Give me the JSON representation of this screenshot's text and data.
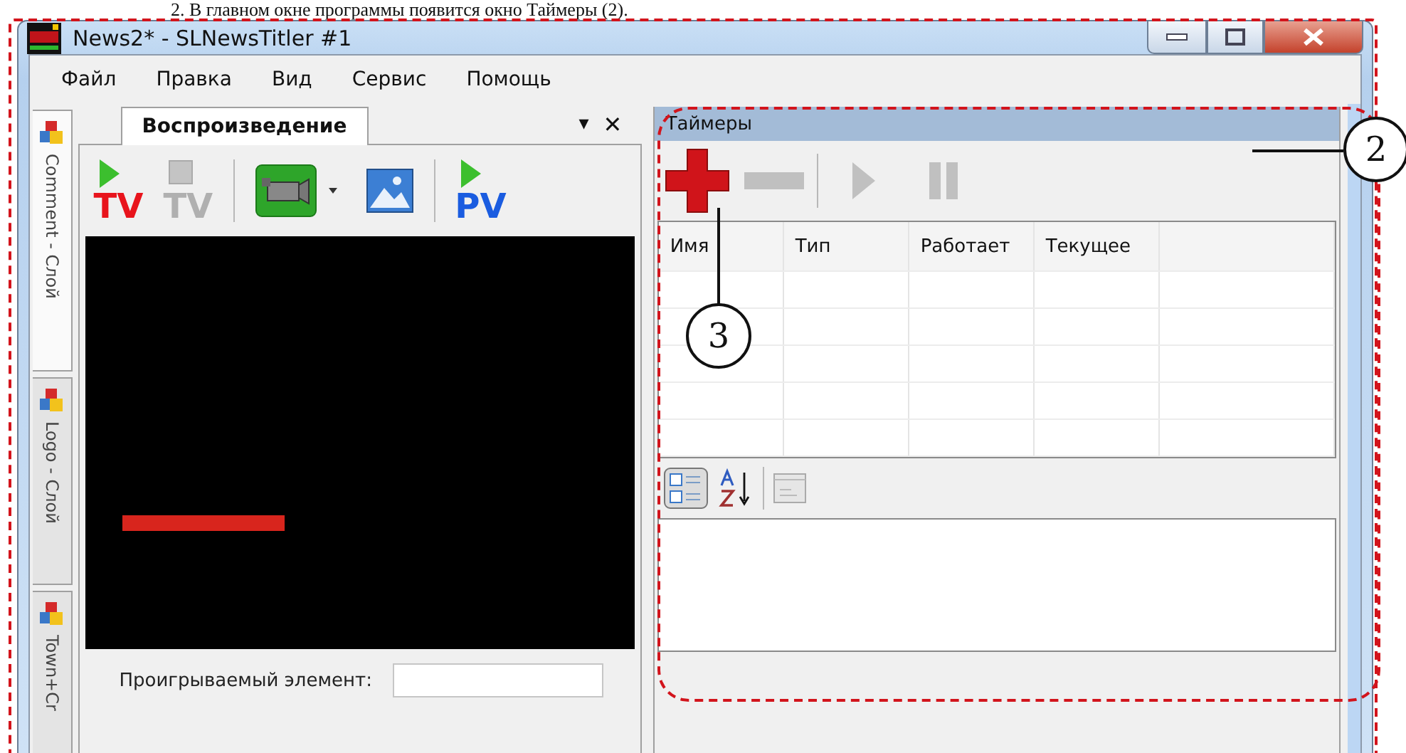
{
  "doc_heading": "2.   В главном окне программы появится окно Таймеры (2).",
  "window": {
    "title": "News2* - SLNewsTitler #1"
  },
  "menu": [
    "Файл",
    "Правка",
    "Вид",
    "Сервис",
    "Помощь"
  ],
  "side_tabs": [
    {
      "label": "Comment - Слой",
      "selected": true
    },
    {
      "label": "Logo - Слой",
      "selected": false
    },
    {
      "label": "Town+Cr",
      "selected": false
    }
  ],
  "playback_panel": {
    "tab": "Воспроизведение",
    "menu_glyph": "▾",
    "close_glyph": "✕",
    "toolbar": [
      {
        "kind": "play",
        "label": "TV",
        "color": "#e8141c",
        "disabled": false
      },
      {
        "kind": "stop",
        "label": "TV",
        "color": "#b0b0b0",
        "disabled": true
      },
      {
        "kind": "separator"
      },
      {
        "kind": "camera"
      },
      {
        "kind": "image"
      },
      {
        "kind": "separator"
      },
      {
        "kind": "play",
        "label": "PV",
        "color": "#1a5ce0",
        "disabled": false
      }
    ],
    "playing_label": "Проигрываемый элемент:"
  },
  "timers_panel": {
    "title": "Таймеры",
    "toolbar": [
      {
        "kind": "add",
        "disabled": false
      },
      {
        "kind": "remove",
        "disabled": true
      },
      {
        "kind": "separator"
      },
      {
        "kind": "start",
        "disabled": true
      },
      {
        "kind": "pause",
        "disabled": true
      }
    ],
    "columns": [
      "Имя",
      "Тип",
      "Работает",
      "Текущее"
    ],
    "property_toolbar": [
      {
        "kind": "categorized",
        "selected": true
      },
      {
        "kind": "alphabetical",
        "selected": false
      },
      {
        "kind": "separator"
      },
      {
        "kind": "pages",
        "disabled": true
      }
    ]
  },
  "callouts": [
    {
      "number": "2"
    },
    {
      "number": "3"
    }
  ]
}
